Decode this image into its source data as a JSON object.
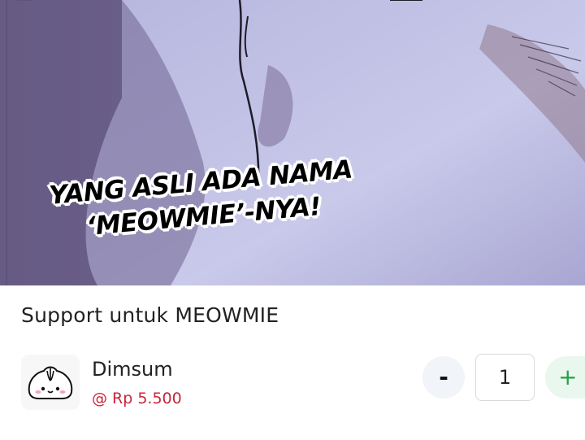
{
  "banner": {
    "caption_line1": "YANG ASLI ADA NAMA",
    "caption_line2": "‘MEOWMIE’-NYA!"
  },
  "support": {
    "title": "Support untuk MEOWMIE"
  },
  "item": {
    "icon": "dimsum-icon",
    "name": "Dimsum",
    "price": "@ Rp 5.500",
    "price_color": "#c8263a",
    "quantity": "1",
    "minus_label": "-",
    "plus_label": "+",
    "plus_color": "#27a047"
  }
}
